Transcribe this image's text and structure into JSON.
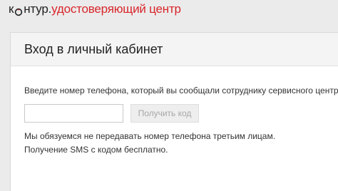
{
  "header": {
    "logo_part1_start": "к",
    "logo_part1_end": "нтур.",
    "logo_part2": "удостоверяющий центр",
    "brand_color": "#d9262b"
  },
  "login": {
    "title": "Вход в личный кабинет",
    "prompt": "Введите номер телефона, который вы сообщали сотруднику сервисного центра:",
    "phone_value": "",
    "get_code_label": "Получить код",
    "note_privacy": "Мы обязуемся не передавать номер телефона третьим лицам.",
    "note_free": "Получение SMS с кодом бесплатно."
  }
}
